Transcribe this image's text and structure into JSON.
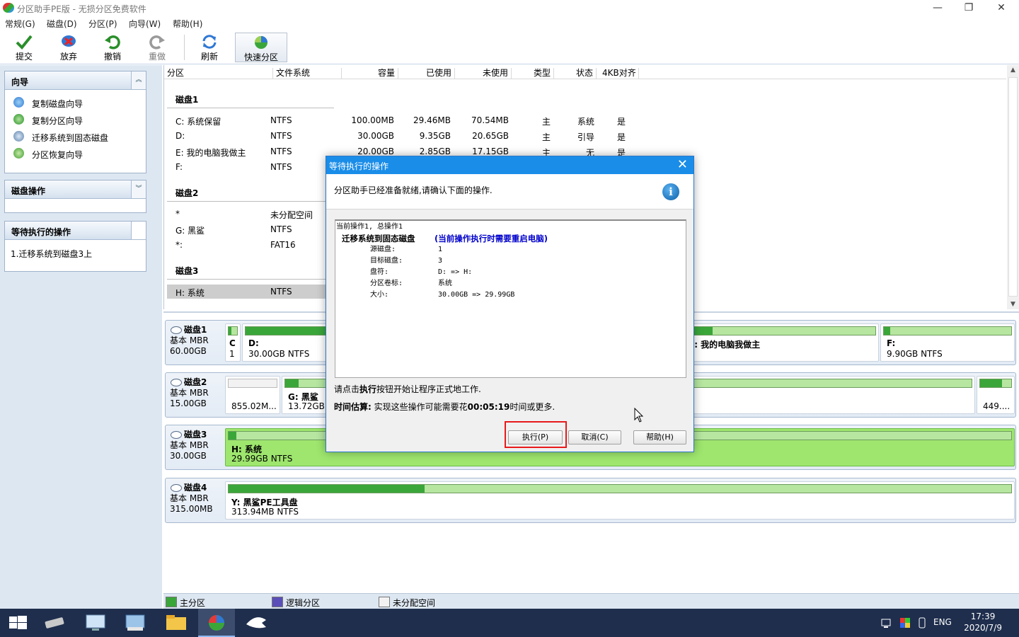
{
  "window": {
    "title": "分区助手PE版 - 无损分区免费软件",
    "minimize": "—",
    "restore": "❐",
    "close": "✕"
  },
  "menu": [
    "常规(G)",
    "磁盘(D)",
    "分区(P)",
    "向导(W)",
    "帮助(H)"
  ],
  "toolbar": {
    "commit": "提交",
    "discard": "放弃",
    "undo": "撤销",
    "redo": "重做",
    "refresh": "刷新",
    "quick_partition": "快速分区"
  },
  "left_panel": {
    "wizard_title": "向导",
    "wizard_items": [
      "复制磁盘向导",
      "复制分区向导",
      "迁移系统到固态磁盘",
      "分区恢复向导"
    ],
    "disk_ops_title": "磁盘操作",
    "pending_title": "等待执行的操作",
    "pending_items": [
      "1.迁移系统到磁盘3上"
    ]
  },
  "partition_list": {
    "headers": [
      "分区",
      "文件系统",
      "容量",
      "已使用",
      "未使用",
      "类型",
      "状态",
      "4KB对齐"
    ],
    "groups": [
      {
        "name": "磁盘1",
        "rows": [
          [
            "C: 系统保留",
            "NTFS",
            "100.00MB",
            "29.46MB",
            "70.54MB",
            "主",
            "系统",
            "是"
          ],
          [
            "D:",
            "NTFS",
            "30.00GB",
            "9.35GB",
            "20.65GB",
            "主",
            "引导",
            "是"
          ],
          [
            "E: 我的电脑我做主",
            "NTFS",
            "20.00GB",
            "2.85GB",
            "17.15GB",
            "主",
            "无",
            "是"
          ],
          [
            "F:",
            "NTFS",
            "",
            "",
            "",
            "",
            "",
            ""
          ]
        ]
      },
      {
        "name": "磁盘2",
        "rows": [
          [
            "*",
            "未分配空间",
            "",
            "",
            "",
            "",
            "",
            ""
          ],
          [
            "G: 黑鲨",
            "NTFS",
            "",
            "",
            "",
            "",
            "",
            ""
          ],
          [
            "*:",
            "FAT16",
            "",
            "",
            "",
            "",
            "",
            ""
          ]
        ]
      },
      {
        "name": "磁盘3",
        "rows": [
          [
            "H: 系统",
            "NTFS",
            "",
            "",
            "",
            "",
            "",
            ""
          ]
        ]
      }
    ]
  },
  "disk_map": {
    "disks": [
      {
        "name": "磁盘1",
        "type": "基本 MBR",
        "size": "60.00GB",
        "parts": [
          {
            "label": "C",
            "detail": "1",
            "used": 0.3
          },
          {
            "label": "D:",
            "detail": "30.00GB NTFS",
            "used": 0.31
          },
          {
            "label": "E: 我的电脑我做主",
            "detail": "",
            "used": 0.14
          },
          {
            "label": "F:",
            "detail": "9.90GB NTFS",
            "used": 0.05
          }
        ]
      },
      {
        "name": "磁盘2",
        "type": "基本 MBR",
        "size": "15.00GB",
        "parts": [
          {
            "label": "",
            "detail": "855.02M...",
            "used": 0
          },
          {
            "label": "G: 黑鲨",
            "detail": "13.72GB",
            "used": 0.02
          },
          {
            "label": "",
            "detail": "449....",
            "used": 0.7
          }
        ]
      },
      {
        "name": "磁盘3",
        "type": "基本 MBR",
        "size": "30.00GB",
        "parts": [
          {
            "label": "H: 系统",
            "detail": "29.99GB NTFS",
            "used": 0.01
          }
        ]
      },
      {
        "name": "磁盘4",
        "type": "基本 MBR",
        "size": "315.00MB",
        "parts": [
          {
            "label": "Y: 黑鲨PE工具盘",
            "detail": "313.94MB NTFS",
            "used": 0.25
          }
        ]
      }
    ]
  },
  "legend": [
    {
      "label": "主分区",
      "color": "#3aa63a"
    },
    {
      "label": "逻辑分区",
      "color": "#5a4fb8"
    },
    {
      "label": "未分配空间",
      "color": "#f2f2f2"
    }
  ],
  "dialog": {
    "title": "等待执行的操作",
    "close": "✕",
    "banner": "分区助手已经准备就绪,请确认下面的操作.",
    "info_icon": "i",
    "log": {
      "line1": "当前操作1, 总操作1",
      "op_title": "迁移系统到固态磁盘",
      "op_note": "(当前操作执行时需要重启电脑)",
      "fields": [
        {
          "k": "源磁盘:",
          "v": "1"
        },
        {
          "k": "目标磁盘:",
          "v": "3"
        },
        {
          "k": "盘符:",
          "v": "D: => H:"
        },
        {
          "k": "分区卷标:",
          "v": "系统"
        },
        {
          "k": "大小:",
          "v": "30.00GB => 29.99GB"
        }
      ]
    },
    "hint_pre": "请点击",
    "hint_bold": "执行",
    "hint_post": "按钮开始让程序正式地工作.",
    "est_label": "时间估算:",
    "est_pre": " 实现这些操作可能需要花",
    "est_time": "00:05:19",
    "est_post": "时间或更多.",
    "execute": "执行(P)",
    "cancel": "取消(C)",
    "help": "帮助(H)"
  },
  "taskbar": {
    "lang": "ENG",
    "time": "17:39",
    "date": "2020/7/9"
  }
}
